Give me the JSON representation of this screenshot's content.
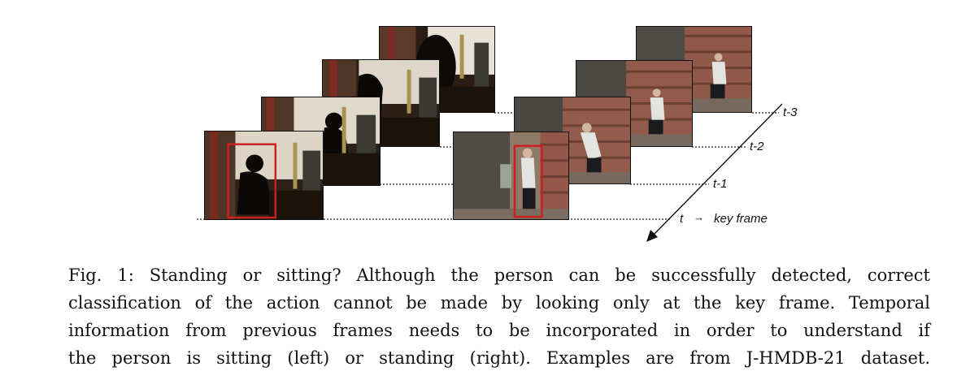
{
  "figure": {
    "time_labels": {
      "t3": "t-3",
      "t2": "t-2",
      "t1": "t-1",
      "t0": "t",
      "arrow": "→",
      "key": "key frame"
    },
    "colors": {
      "bbox": "#cc1f1f",
      "dotted": "#222222"
    }
  },
  "caption": {
    "lines": [
      "Fig. 1: Standing or sitting? Although the person can be successfully detected, correct",
      "classification of the action cannot be made by looking only at the key frame. Temporal",
      "information from previous frames needs to be incorporated in order to understand if",
      "the person is sitting (left) or standing (right). Examples are from J-HMDB-21 dataset."
    ]
  }
}
